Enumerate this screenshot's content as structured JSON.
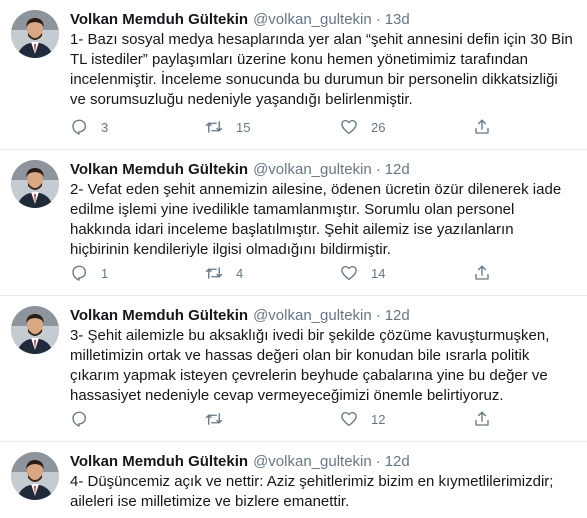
{
  "author": {
    "name": "Volkan Memduh Gültekin",
    "handle": "@volkan_gultekin"
  },
  "separator": "·",
  "tweets": [
    {
      "time": "13d",
      "text": "1- Bazı sosyal medya hesaplarında yer alan “şehit annesini defin için 30 Bin TL istediler” paylaşımları üzerine konu hemen yönetimimiz tarafından incelenmiştir. İnceleme sonucunda bu durumun bir personelin dikkatsizliği ve sorumsuzluğu nedeniyle yaşandığı belirlenmiştir.",
      "replies": "3",
      "retweets": "15",
      "likes": "26"
    },
    {
      "time": "12d",
      "text": "2- Vefat eden şehit annemizin ailesine, ödenen ücretin özür dilenerek iade edilme işlemi yine ivedilikle tamamlanmıştır. Sorumlu olan personel hakkında idari inceleme başlatılmıştır. Şehit ailemiz ise yazılanların hiçbirinin kendileriyle ilgisi olmadığını bildirmiştir.",
      "replies": "1",
      "retweets": "4",
      "likes": "14"
    },
    {
      "time": "12d",
      "text": "3- Şehit ailemizle bu aksaklığı ivedi bir şekilde çözüme kavuşturmuşken, milletimizin ortak ve hassas değeri olan bir konudan bile ısrarla politik çıkarım yapmak isteyen çevrelerin beyhude çabalarına yine bu değer ve hassasiyet nedeniyle cevap vermeyeceğimizi önemle belirtiyoruz.",
      "replies": "",
      "retweets": "",
      "likes": "12"
    },
    {
      "time": "12d",
      "text": "4- Düşüncemiz açık ve nettir: Aziz şehitlerimiz bizim en kıymetlilerimizdir; aileleri ise milletimize ve bizlere emanettir."
    }
  ],
  "icons": {
    "reply": "reply-icon",
    "retweet": "retweet-icon",
    "like": "heart-icon",
    "share": "share-icon"
  },
  "colors": {
    "text": "#14171a",
    "muted": "#657786",
    "divider": "#e6ecf0"
  }
}
